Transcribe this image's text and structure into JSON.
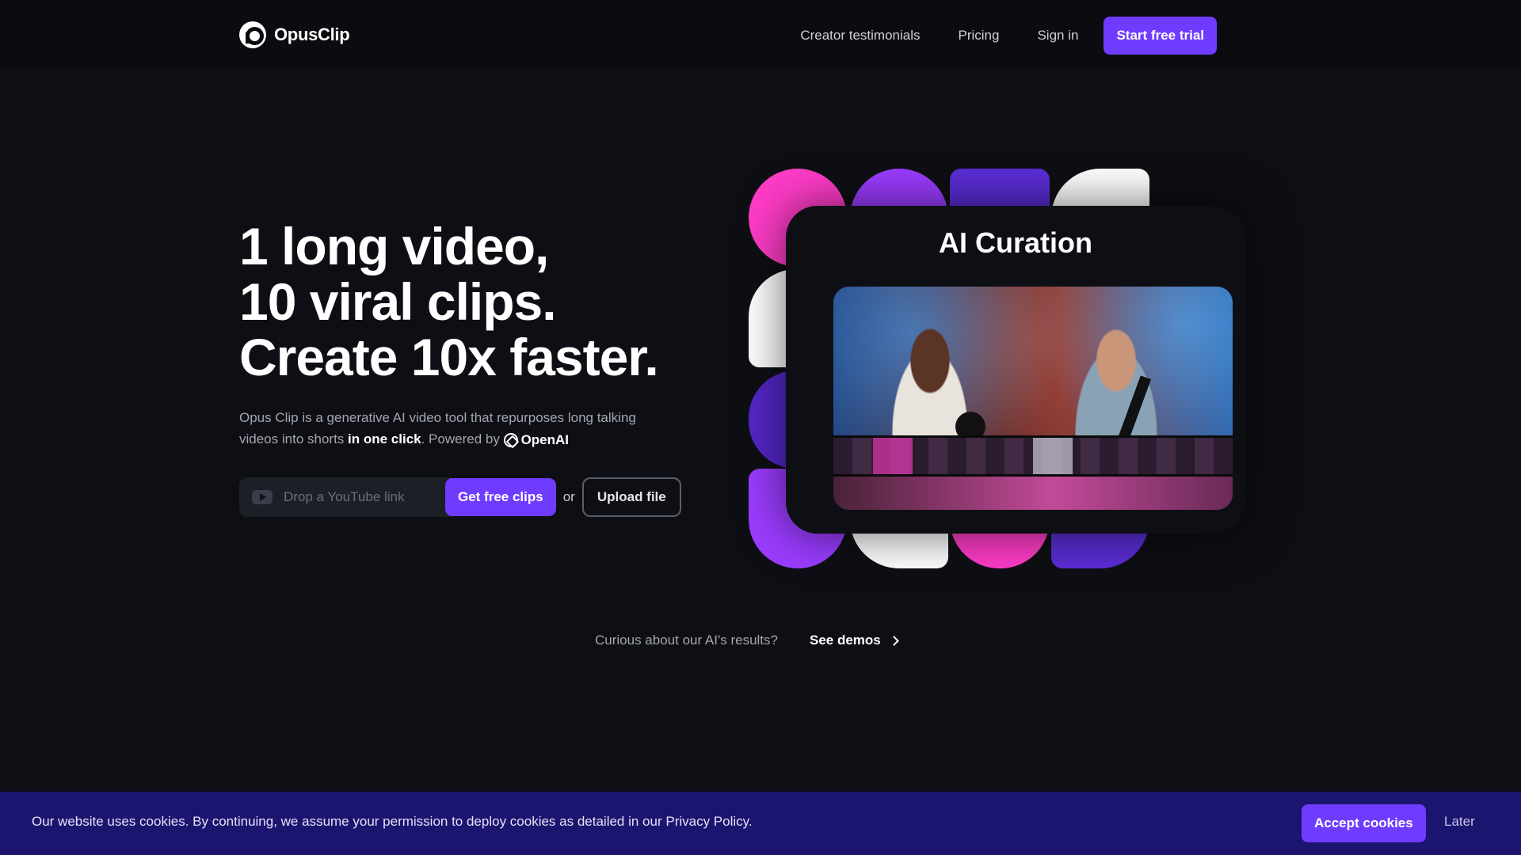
{
  "nav": {
    "logo_text": "OpusClip",
    "links": [
      "Creator testimonials",
      "Pricing",
      "Sign in"
    ],
    "cta": "Start free trial"
  },
  "hero": {
    "title_lines": [
      "1 long video,",
      "10 viral clips.",
      "Create 10x faster."
    ],
    "desc_before": "Opus Clip is a generative AI video tool that repurposes long talking videos into shorts ",
    "desc_bold": "in one click",
    "desc_after": ". Powered by ",
    "powered_by": "OpenAI",
    "input_placeholder": "Drop a YouTube link",
    "get_clips": "Get free clips",
    "or": "or",
    "upload": "Upload file"
  },
  "visual": {
    "card_title": "AI Curation"
  },
  "demos": {
    "question": "Curious about our AI's results?",
    "link": "See demos"
  },
  "cookie": {
    "text": "Our website uses cookies. By continuing, we assume your permission to deploy cookies as detailed in our Privacy Policy.",
    "accept": "Accept cookies",
    "later": "Later"
  },
  "colors": {
    "accent": "#6f3cff",
    "pink": "#ff3cc7",
    "purple": "#9b3cff",
    "indigo": "#5b2dd6",
    "background": "#0e0f14",
    "cookie_bar": "#1c1570"
  }
}
